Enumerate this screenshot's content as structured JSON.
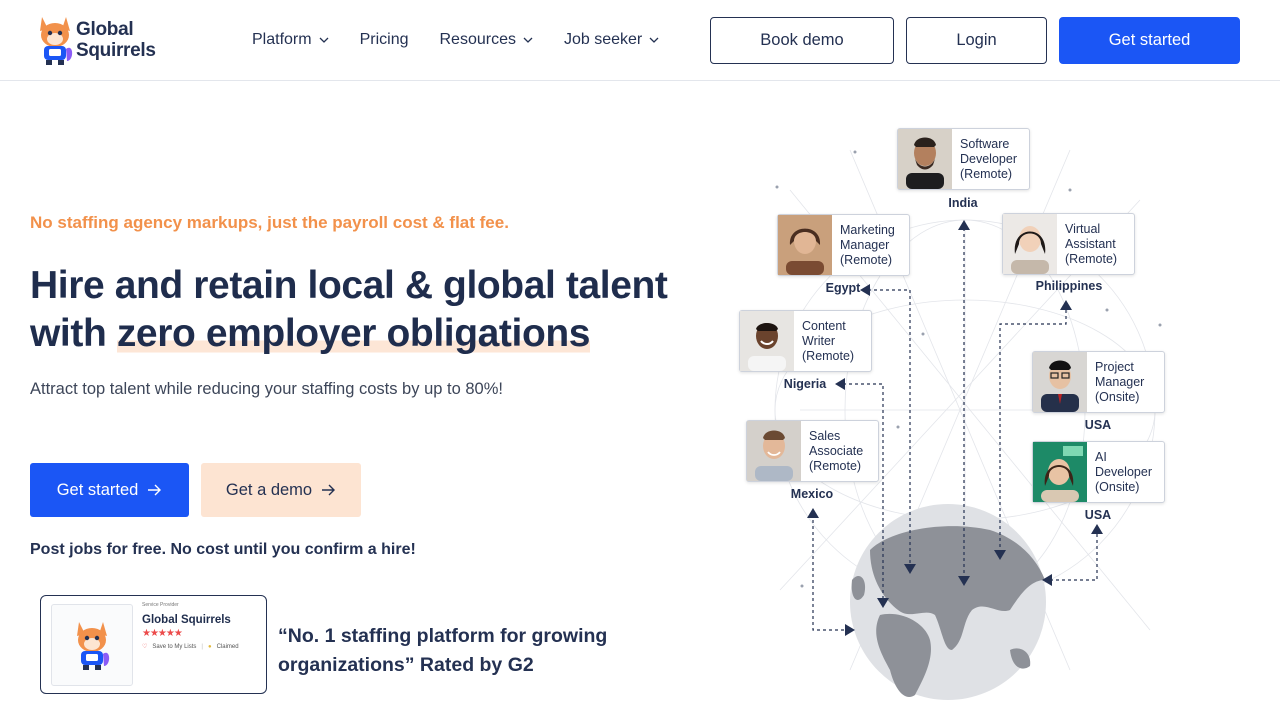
{
  "header": {
    "logo_line1": "Global",
    "logo_line2": "Squirrels",
    "nav": [
      {
        "label": "Platform",
        "has_dropdown": true
      },
      {
        "label": "Pricing",
        "has_dropdown": false
      },
      {
        "label": "Resources",
        "has_dropdown": true
      },
      {
        "label": "Job seeker",
        "has_dropdown": true
      }
    ],
    "book_demo": "Book demo",
    "login": "Login",
    "get_started": "Get started"
  },
  "hero": {
    "tagline": "No staffing agency markups, just the payroll cost & flat fee.",
    "headline_part1": "Hire and retain local & global talent with ",
    "headline_highlight": "zero employer obligations",
    "subheadline": "Attract top talent while reducing your staffing costs by up to 80%!",
    "cta_primary": "Get started",
    "cta_secondary": "Get a demo",
    "post_note": "Post jobs for free. No cost until you confirm a hire!"
  },
  "g2": {
    "label": "Service Provider",
    "name": "Global Squirrels",
    "stars": "★★★★★",
    "save": "Save to My Lists",
    "claimed": "Claimed",
    "quote": "“No. 1 staffing platform for growing organizations” Rated by G2"
  },
  "talent": [
    {
      "role": "Software Developer (Remote)",
      "country": "India"
    },
    {
      "role": "Marketing Manager (Remote)",
      "country": "Egypt"
    },
    {
      "role": "Virtual Assistant (Remote)",
      "country": "Philippines"
    },
    {
      "role": "Content Writer (Remote)",
      "country": "Nigeria"
    },
    {
      "role": "Project Manager (Onsite)",
      "country": "USA"
    },
    {
      "role": "Sales Associate (Remote)",
      "country": "Mexico"
    },
    {
      "role": "AI Developer (Onsite)",
      "country": "USA"
    }
  ],
  "colors": {
    "primary": "#1b56f5",
    "navy": "#243152",
    "accent_orange": "#f2914b",
    "peach": "#fde4d2"
  }
}
